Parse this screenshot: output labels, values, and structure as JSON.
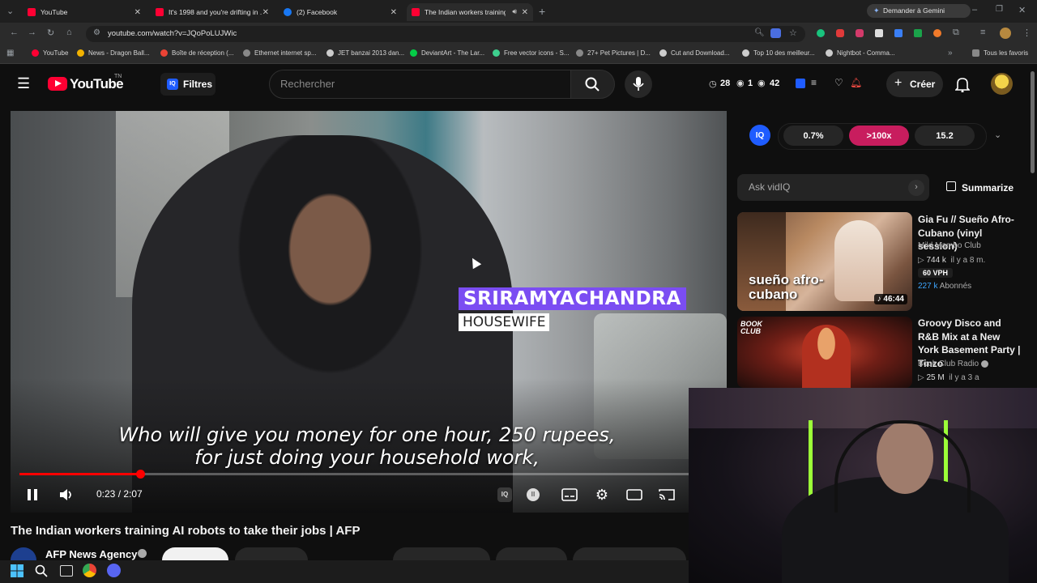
{
  "browser": {
    "tabs": [
      {
        "title": "YouTube",
        "favicon_color": "#ff0033"
      },
      {
        "title": "It's 1998 and you're drifting in ...",
        "favicon_color": "#ff0033"
      },
      {
        "title": "(2) Facebook",
        "favicon_color": "#1877f2"
      },
      {
        "title": "The Indian workers training",
        "favicon_color": "#ff0033",
        "active": true
      }
    ],
    "gemini_button": "Demander à Gemini",
    "url": "youtube.com/watch?v=JQoPoLUJWic",
    "bookmarks": [
      {
        "label": "YouTube",
        "color": "#ff0033"
      },
      {
        "label": "News - Dragon Ball...",
        "color": "#f2b200"
      },
      {
        "label": "Boîte de réception (...",
        "color": "#ea4335"
      },
      {
        "label": "Ethernet internet sp...",
        "color": "#888888"
      },
      {
        "label": "JET banzai 2013 dan...",
        "color": "#cccccc"
      },
      {
        "label": "DeviantArt - The Lar...",
        "color": "#05cc47"
      },
      {
        "label": "Free vector icons - S...",
        "color": "#3ecf8e"
      },
      {
        "label": "27+ Pet Pictures | D...",
        "color": "#888888"
      },
      {
        "label": "Cut and Download...",
        "color": "#cccccc"
      },
      {
        "label": "Top 10 des meilleur...",
        "color": "#cccccc"
      },
      {
        "label": "Nightbot - Comma...",
        "color": "#cccccc"
      }
    ],
    "all_bookmarks": "Tous les favoris"
  },
  "youtube": {
    "logo_text": "YouTube",
    "logo_region": "TN",
    "filters_label": "Filtres",
    "search_placeholder": "Rechercher",
    "header_stats": {
      "a": "28",
      "b": "1",
      "c": "42"
    },
    "create_label": "Créer"
  },
  "player": {
    "lower_third_name": "SRIRAMYACHANDRA",
    "lower_third_role": "HOUSEWIFE",
    "subtitle_line1": "Who will give you money for one hour, 250 rupees,",
    "subtitle_line2": "for just doing your household work,",
    "time": "0:23 / 2:07",
    "progress_fraction": 0.18
  },
  "video": {
    "title": "The Indian workers training AI robots to take their jobs | AFP",
    "channel": "AFP News Agency"
  },
  "vidiq": {
    "icon": "IQ",
    "stats": [
      "0.7%",
      ">100x",
      "15.2"
    ],
    "ask_placeholder": "Ask vidIQ",
    "summarize": "Summarize"
  },
  "recommendations": [
    {
      "title": "Gia Fu // Sueño Afro-Cubano (vinyl session)",
      "channel": "Mild Mambo Club",
      "views": "744 k",
      "age": "il y a 8 m.",
      "vph": "60 VPH",
      "subscribers": "227 k",
      "subscribers_label": "Abonnés",
      "duration": "46:44",
      "thumb_text": "sueño afro-cubano"
    },
    {
      "title": "Groovy Disco and R&B Mix at a New York Basement Party | Tinzo",
      "channel": "Book Club Radio",
      "views": "25 M",
      "age": "il y a 3 a",
      "thumb_text": "BOOK CLUB"
    }
  ]
}
